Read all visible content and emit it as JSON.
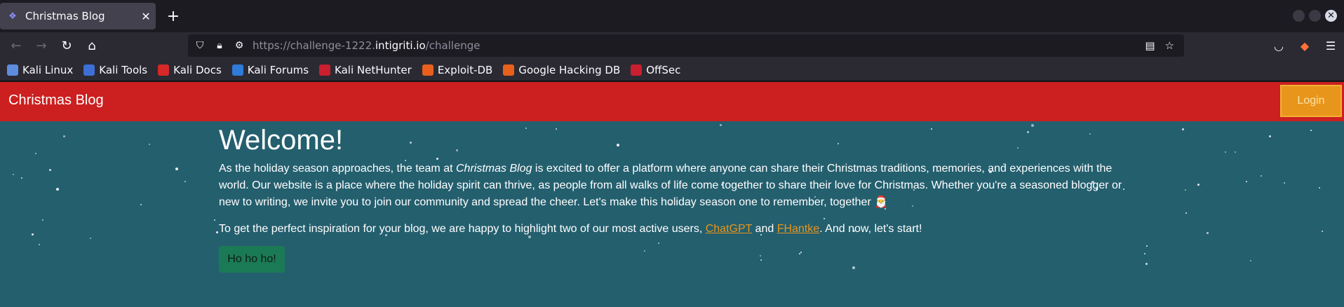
{
  "browser": {
    "tab_title": "Christmas Blog",
    "url_prefix": "https://challenge-1222.",
    "url_host": "intigriti.io",
    "url_path": "/challenge",
    "bookmarks": [
      {
        "label": "Kali Linux",
        "color": "#5e8de0"
      },
      {
        "label": "Kali Tools",
        "color": "#3d6fd6"
      },
      {
        "label": "Kali Docs",
        "color": "#d62828"
      },
      {
        "label": "Kali Forums",
        "color": "#2f7bd9"
      },
      {
        "label": "Kali NetHunter",
        "color": "#c91f2f"
      },
      {
        "label": "Exploit-DB",
        "color": "#e8601c"
      },
      {
        "label": "Google Hacking DB",
        "color": "#e8601c"
      },
      {
        "label": "OffSec",
        "color": "#c91f2f"
      }
    ]
  },
  "site": {
    "brand": "Christmas Blog",
    "login_label": "Login",
    "heading": "Welcome!",
    "para1_start": "As the holiday season approaches, the team at ",
    "para1_em": "Christmas Blog",
    "para1_end": " is excited to offer a platform where anyone can share their Christmas traditions, memories, and experiences with the world. Our website is a place where the holiday spirit can thrive, as people from all walks of life come together to share their love for Christmas. Whether you're a seasoned blogger or new to writing, we invite you to join our community and spread the cheer. Let's make this holiday season one to remember, together 🎅",
    "para2_start": "To get the perfect inspiration for your blog, we are happy to highlight two of our most active users, ",
    "link1": "ChatGPT",
    "para2_mid": " and ",
    "link2": "FHantke",
    "para2_end": ". And now, let's start!",
    "button_label": "Ho ho ho!"
  },
  "colors": {
    "header_red": "#cc1f1f",
    "main_bg": "#245f6e",
    "accent_orange": "#e8951b",
    "button_green": "#1a7a55"
  }
}
